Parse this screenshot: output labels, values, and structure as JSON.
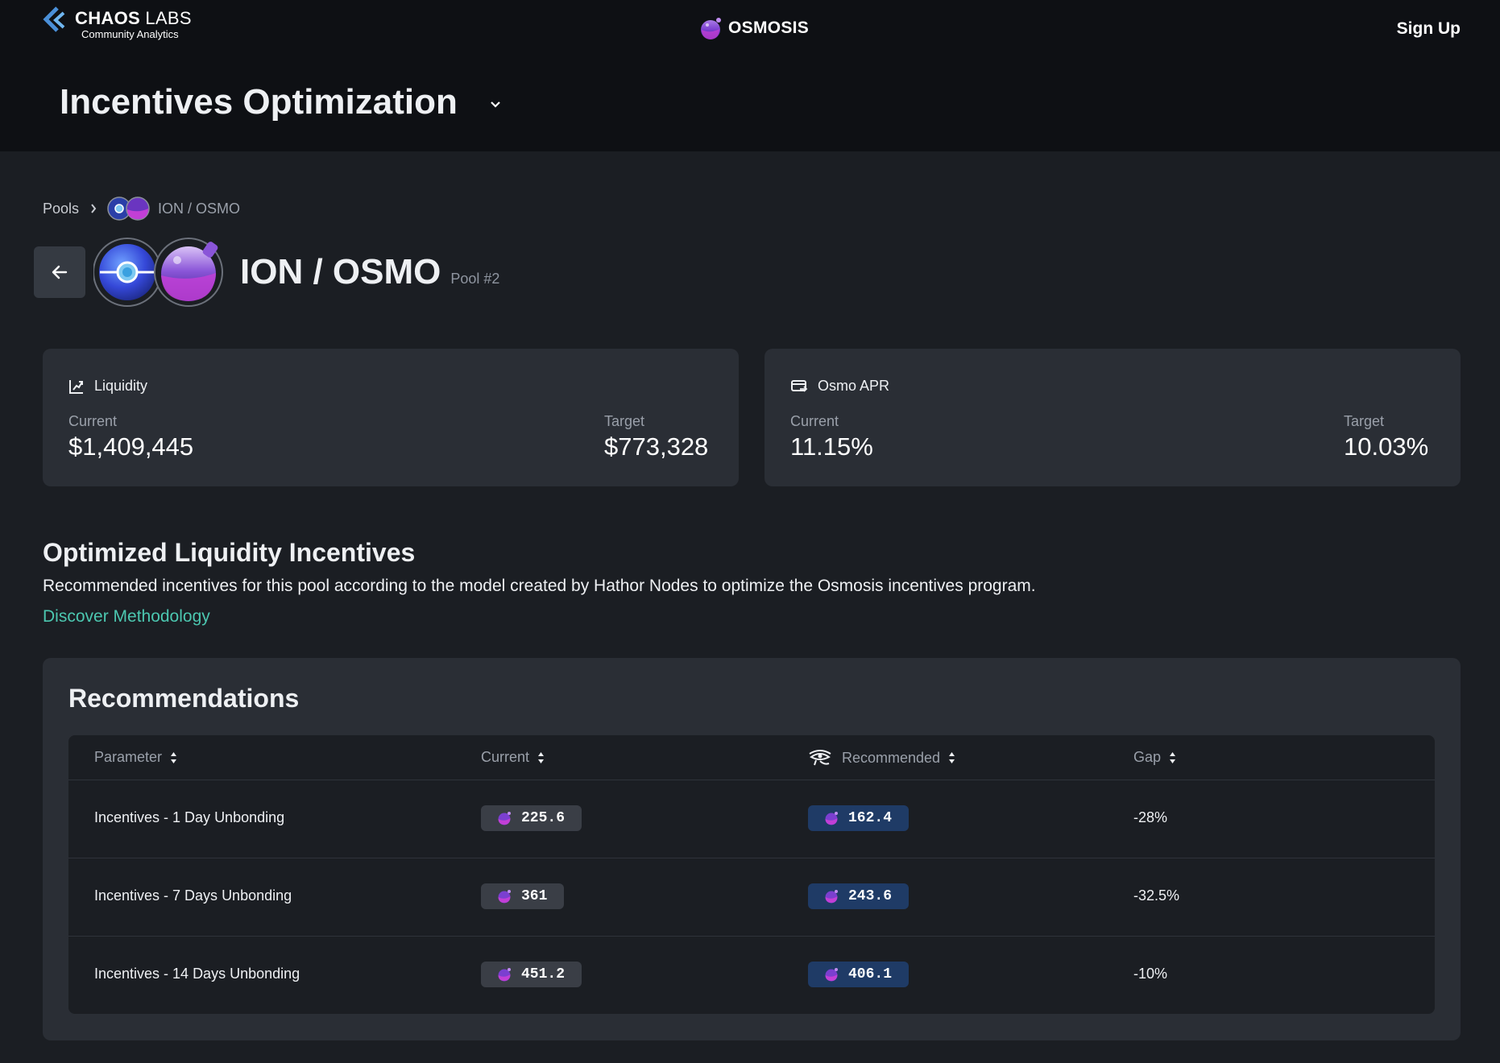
{
  "header": {
    "brand_name_bold": "CHAOS",
    "brand_name_rest": " LABS",
    "brand_sub": "Community Analytics",
    "network": "OSMOSIS",
    "signup_label": "Sign Up",
    "page_title": "Incentives Optimization"
  },
  "breadcrumb": {
    "root": "Pools",
    "current": "ION / OSMO"
  },
  "pool": {
    "name": "ION / OSMO",
    "number": "Pool #2"
  },
  "cards": {
    "liquidity": {
      "title": "Liquidity",
      "current_label": "Current",
      "current_value": "$1,409,445",
      "target_label": "Target",
      "target_value": "$773,328"
    },
    "apr": {
      "title": "Osmo APR",
      "current_label": "Current",
      "current_value": "11.15%",
      "target_label": "Target",
      "target_value": "10.03%"
    }
  },
  "section": {
    "title": "Optimized Liquidity Incentives",
    "description": "Recommended incentives for this pool according to the model created by Hathor Nodes to optimize the Osmosis incentives program.",
    "link": "Discover Methodology"
  },
  "recommendations": {
    "title": "Recommendations",
    "columns": [
      "Parameter",
      "Current",
      "Recommended",
      "Gap"
    ],
    "rows": [
      {
        "parameter": "Incentives - 1 Day Unbonding",
        "current": "225.6",
        "recommended": "162.4",
        "gap": "-28%"
      },
      {
        "parameter": "Incentives - 7 Days Unbonding",
        "current": "361",
        "recommended": "243.6",
        "gap": "-32.5%"
      },
      {
        "parameter": "Incentives - 14 Days Unbonding",
        "current": "451.2",
        "recommended": "406.1",
        "gap": "-10%"
      }
    ]
  },
  "colors": {
    "background": "#1b1e23",
    "topbar": "#0e1014",
    "card": "#2a2e35",
    "link": "#4cc7b0",
    "recommended_pill": "#1f3b66",
    "current_pill": "#3a3e46"
  },
  "icons": {
    "brand": "chaos-labs-logo-icon",
    "network": "osmosis-logo-icon",
    "liquidity": "chart-growth-icon",
    "apr": "card-exchange-icon",
    "recommended_col": "eye-of-horus-icon",
    "sort": "sort-icon",
    "back": "arrow-left-icon"
  }
}
